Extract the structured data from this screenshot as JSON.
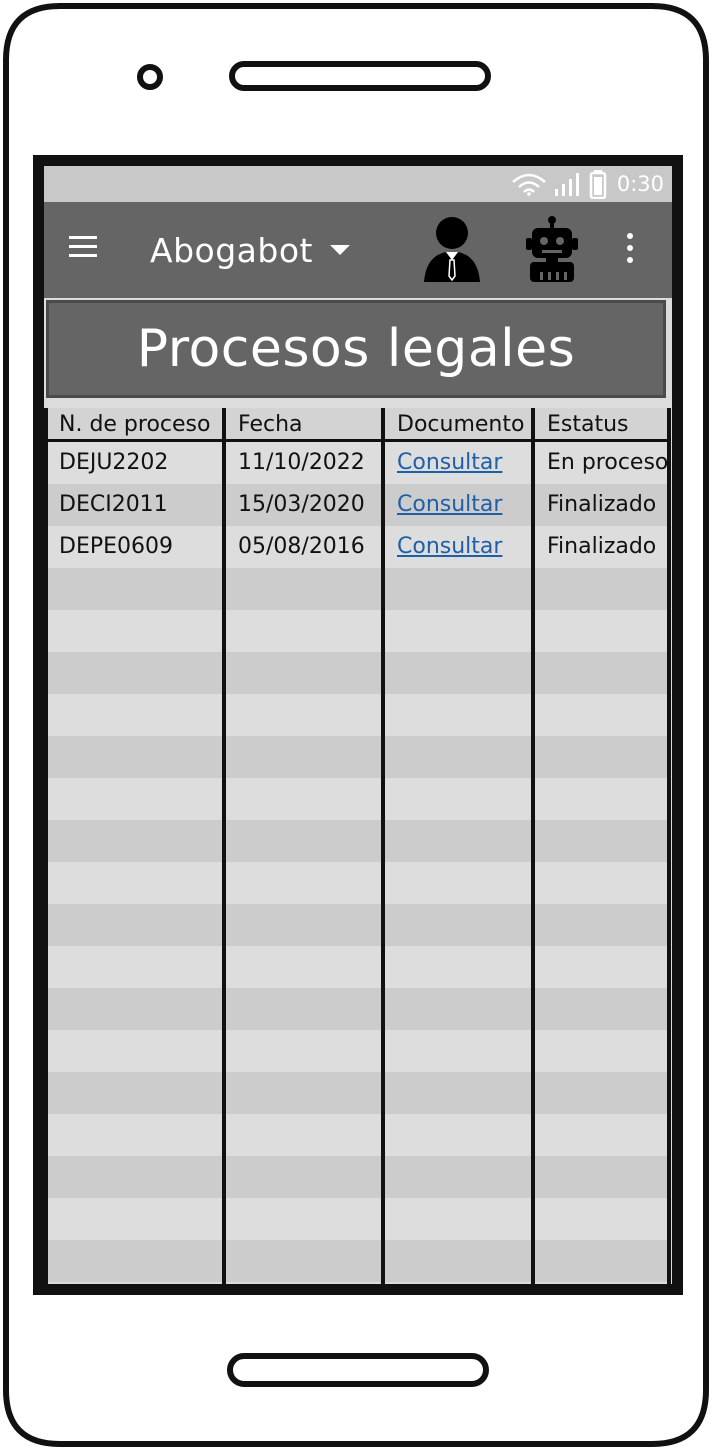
{
  "status_bar": {
    "time": "0:30",
    "icons": [
      "wifi-icon",
      "signal-icon",
      "battery-icon"
    ]
  },
  "app_bar": {
    "title": "Abogabot",
    "icons": [
      "menu-icon",
      "dropdown-caret-icon",
      "user-icon",
      "robot-icon",
      "more-vertical-icon"
    ]
  },
  "page": {
    "title": "Procesos legales"
  },
  "table": {
    "columns": [
      "N. de proceso",
      "Fecha",
      "Documento",
      "Estatus"
    ],
    "rows": [
      {
        "proceso": "DEJU2202",
        "fecha": "11/10/2022",
        "documento": "Consultar",
        "estatus": "En proceso"
      },
      {
        "proceso": "DECI2011",
        "fecha": "15/03/2020",
        "documento": "Consultar",
        "estatus": "Finalizado"
      },
      {
        "proceso": "DEPE0609",
        "fecha": "05/08/2016",
        "documento": "Consultar",
        "estatus": "Finalizado"
      }
    ],
    "empty_rows": 17
  },
  "colors": {
    "app_bar": "#656565",
    "status_bar": "#c8c8c8",
    "row_light": "#dddddd",
    "row_dark": "#cccccc",
    "link": "#1f5fa8"
  }
}
